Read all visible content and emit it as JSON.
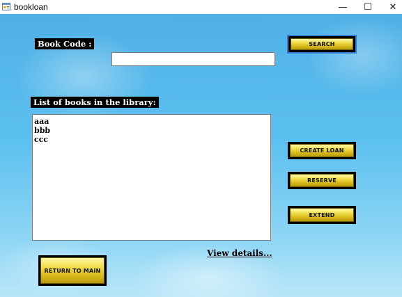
{
  "window": {
    "title": "bookloan",
    "controls": {
      "minimize": "—",
      "maximize": "☐",
      "close": "✕"
    }
  },
  "form": {
    "book_code_label": "Book Code :",
    "book_code_value": "",
    "search_label": "SEARCH",
    "list_label": "List of books in the library:",
    "books": [
      "aaa",
      "bbb",
      "ccc"
    ],
    "create_loan_label": "CREATE LOAN",
    "reserve_label": "RESERVE",
    "extend_label": "EXTEND",
    "view_details_label": "View details...",
    "return_label": "RETURN TO MAIN"
  },
  "colors": {
    "button_gold": "#e8cf3a",
    "background_sky": "#5cc0ef",
    "search_focus": "#2f7fd6"
  },
  "icons": {
    "app": "form-window-icon"
  }
}
